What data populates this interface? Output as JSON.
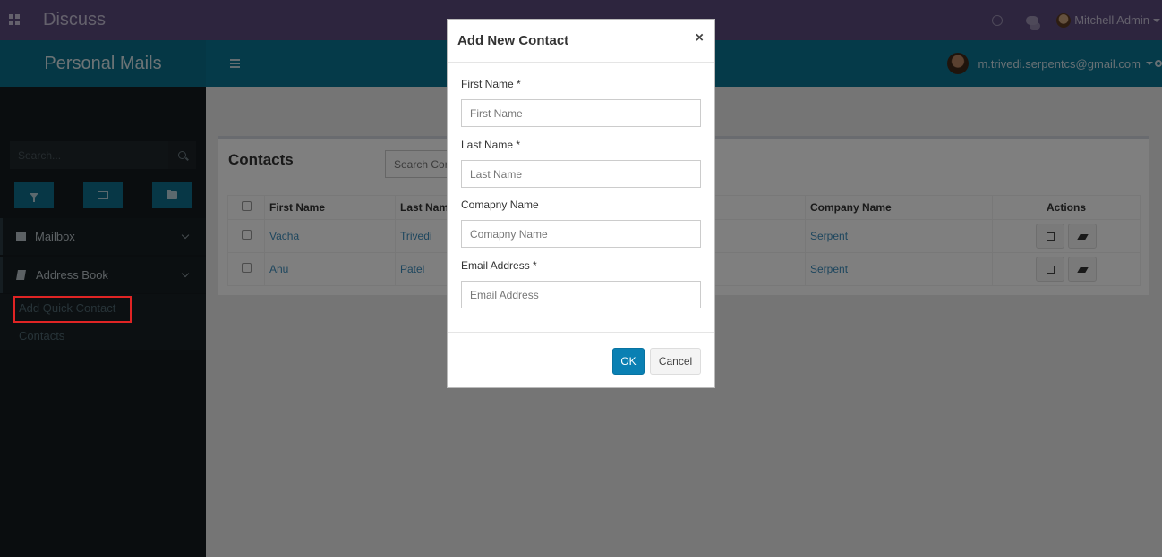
{
  "topbar": {
    "app_title": "Discuss",
    "user_name": "Mitchell Admin"
  },
  "brandbar": {
    "title": "Personal Mails"
  },
  "header": {
    "account_email": "m.trivedi.serpentcs@gmail.com"
  },
  "sidebar": {
    "search_placeholder": "Search...",
    "menu": [
      {
        "label": "Mailbox"
      },
      {
        "label": "Address Book"
      }
    ],
    "submenu": [
      {
        "label": "Add Quick Contact"
      },
      {
        "label": "Contacts"
      }
    ]
  },
  "panel": {
    "title": "Contacts",
    "search_placeholder": "Search Contacts",
    "columns": [
      "First Name",
      "Last Name",
      "Company Name",
      "Actions"
    ],
    "rows": [
      {
        "first": "Vacha",
        "last": "Trivedi",
        "company": "Serpent"
      },
      {
        "first": "Anu",
        "last": "Patel",
        "company": "Serpent"
      }
    ]
  },
  "modal": {
    "title": "Add New Contact",
    "close": "×",
    "fields": [
      {
        "label": "First Name *",
        "placeholder": "First Name"
      },
      {
        "label": "Last Name *",
        "placeholder": "Last Name"
      },
      {
        "label": "Comapny Name",
        "placeholder": "Comapny Name"
      },
      {
        "label": "Email Address *",
        "placeholder": "Email Address"
      }
    ],
    "ok_label": "OK",
    "cancel_label": "Cancel"
  },
  "colors": {
    "topbar": "#5b4b7d",
    "header": "#0b7493",
    "sidebar": "#141a1e",
    "primary_button": "#0a80b3",
    "highlight": "#e02424"
  },
  "icons": [
    "apps-grid-icon",
    "clock-icon",
    "chat-icon",
    "hamburger-icon",
    "search-icon",
    "filter-icon",
    "envelope-icon",
    "folder-icon",
    "book-icon",
    "edit-icon",
    "eraser-icon",
    "close-icon"
  ]
}
